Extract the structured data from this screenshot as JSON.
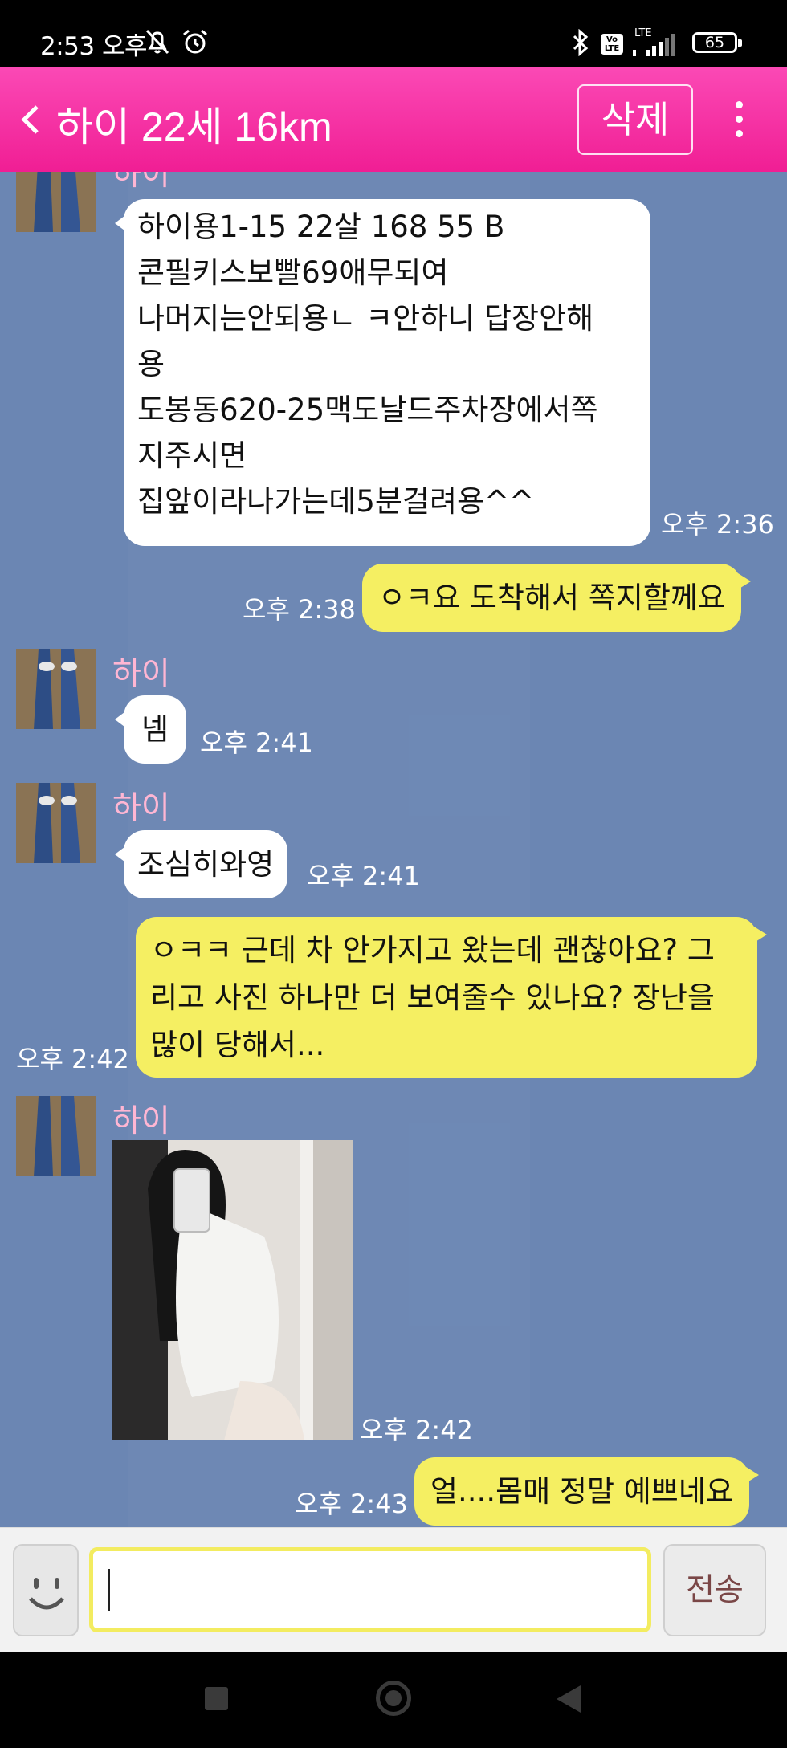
{
  "status_bar": {
    "time": "2:53 오후",
    "battery": "65",
    "network": "LTE",
    "volte_badge": "Vo LTE",
    "icons": [
      "mute-bell-icon",
      "alarm-icon",
      "bluetooth-icon",
      "volte-icon",
      "signal-icon",
      "battery-icon"
    ]
  },
  "header": {
    "title": "하이 22세 16km",
    "delete_label": "삭제",
    "icons": [
      "back-chevron-icon",
      "more-vert-icon"
    ],
    "colors": {
      "gradient_top": "#fb49b5",
      "gradient_bottom": "#f01e94"
    }
  },
  "chat": {
    "background": "#6b86b3",
    "messages": [
      {
        "sender": "하이",
        "side": "left",
        "lines": [
          "하이용1-15 22살 168 55 B",
          "콘필키스보빨69애무되여",
          "나머지는안되용ㄴ ㅋ안하니 답장안해",
          "용",
          "도봉동620-25맥도날드주차장에서쪽",
          "지주시면",
          "집앞이라나가는데5분걸려용^^"
        ],
        "time": "오후 2:36"
      },
      {
        "sender": "me",
        "side": "right",
        "text": "ㅇㅋ요 도착해서 쪽지할께요",
        "time": "오후 2:38"
      },
      {
        "sender": "하이",
        "side": "left",
        "text": "넴",
        "time": "오후 2:41"
      },
      {
        "sender": "하이",
        "side": "left",
        "text": "조심히와영",
        "time": "오후 2:41"
      },
      {
        "sender": "me",
        "side": "right",
        "lines": [
          "ㅇㅋㅋ 근데 차 안가지고 왔는데 괜찮아요? 그",
          "리고 사진 하나만 더 보여줄수 있나요? 장난을",
          "많이 당해서..."
        ],
        "time": "오후 2:42"
      },
      {
        "sender": "하이",
        "side": "left",
        "type": "photo",
        "time": "오후 2:42"
      },
      {
        "sender": "me",
        "side": "right",
        "text": "얼....몸매 정말 예쁘네요",
        "time": "오후 2:43"
      }
    ]
  },
  "input_bar": {
    "send_label": "전송",
    "value": "",
    "icons": [
      "smiley-icon"
    ]
  },
  "nav_bar": {
    "icons": [
      "recents-square-icon",
      "home-circle-icon",
      "back-triangle-icon"
    ]
  }
}
